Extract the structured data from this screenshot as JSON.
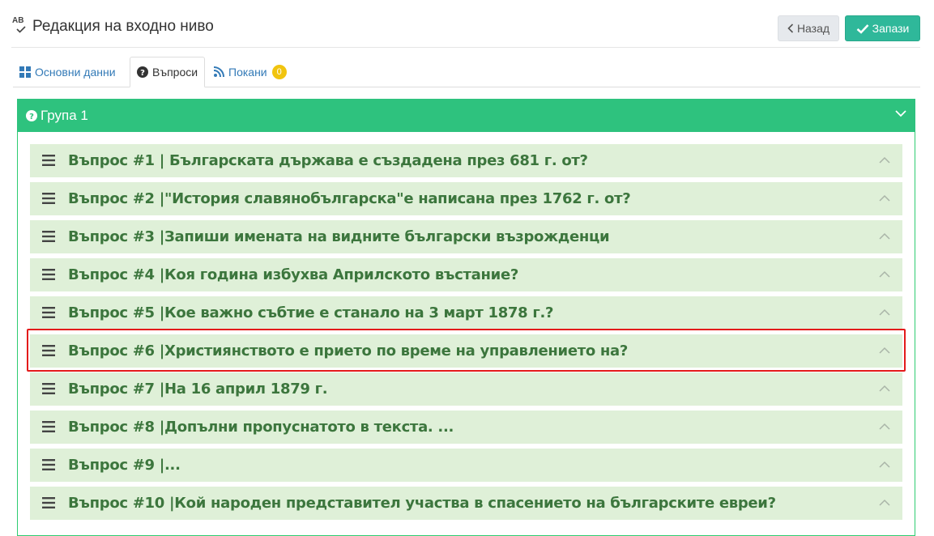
{
  "header": {
    "title": "Редакция на входно ниво",
    "back_label": "Назад",
    "save_label": "Запази"
  },
  "tabs": [
    {
      "label": "Основни данни",
      "icon": "grid-icon",
      "active": false
    },
    {
      "label": "Въпроси",
      "icon": "question-circle-icon",
      "active": true
    },
    {
      "label": "Покани",
      "icon": "rss-icon",
      "active": false,
      "badge": "0"
    }
  ],
  "group": {
    "title": "Група 1",
    "questions": [
      "Въпрос #1 | Българската държава е създадена през 681 г. от?",
      "Въпрос #2 |\"История славянобългарска\"е написана през 1762 г. от?",
      "Въпрос #3 |Запиши имената на видните български възрожденци",
      "Въпрос #4 |Коя година избухва Априлското въстание?",
      "Въпрос #5 |Кое важно събтие е станало на 3 март 1878 г.?",
      "Въпрос #6 |Християнството е прието по време на управлението на?",
      "Въпрос #7 |На 16 април 1879 г.",
      "Въпрос #8 |Допълни пропуснатото в текста. ...",
      "Въпрос #9 |...",
      "Въпрос #10 |Кой народен представител участва в спасението на българските евреи?"
    ]
  },
  "colors": {
    "accent": "#2ec27e",
    "row_bg": "#dff0d8",
    "row_text": "#3c763d",
    "highlight": "#e31b1b"
  }
}
